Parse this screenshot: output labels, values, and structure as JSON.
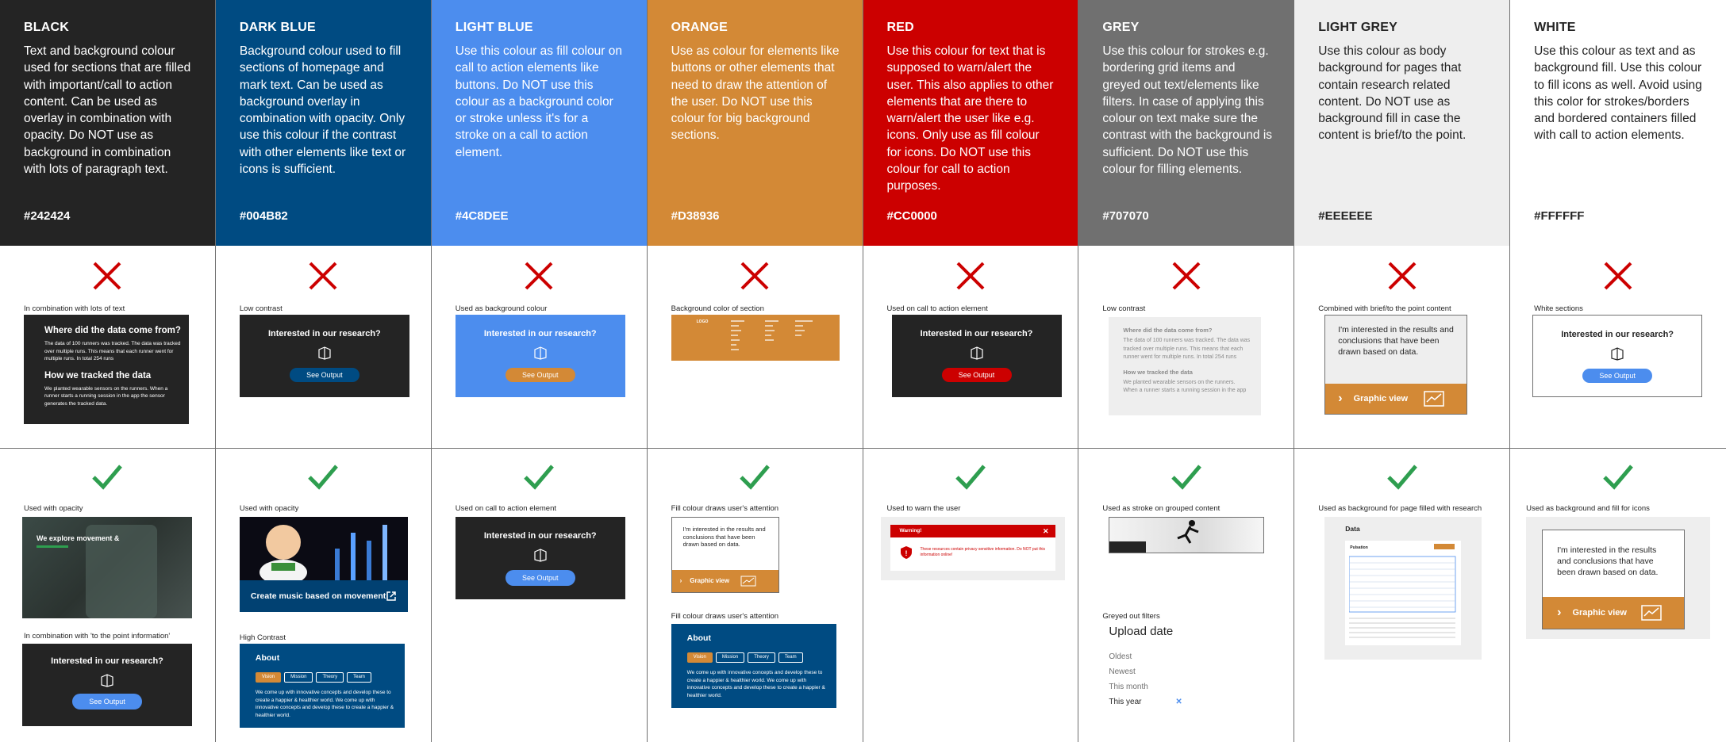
{
  "columns": [
    {
      "key": "black",
      "name": "BLACK",
      "bg": "#242424",
      "fg": "#FFFFFF",
      "hex": "#242424",
      "desc": "Text and background colour used for sections that are filled with important/call to action content. Can be used as overlay in combination with opacity. Do NOT use as background in combination with lots of paragraph text.",
      "dont_caption": "In combination with lots of text",
      "do_caption": "Used with opacity",
      "do_caption2": "In combination with 'to the point information'"
    },
    {
      "key": "darkblue",
      "name": "DARK BLUE",
      "bg": "#004B82",
      "fg": "#FFFFFF",
      "hex": "#004B82",
      "desc": "Background colour used to fill sections of homepage and mark text. Can be used as background overlay in combination with opacity. Only use this colour if the contrast with other elements like text or icons is sufficient.",
      "dont_caption": "Low contrast",
      "do_caption": "Used with opacity",
      "do_caption2": "High Contrast"
    },
    {
      "key": "lightblue",
      "name": "LIGHT BLUE",
      "bg": "#4C8DEE",
      "fg": "#FFFFFF",
      "hex": "#4C8DEE",
      "desc": "Use this colour as fill colour on call to action elements like buttons. Do NOT use this colour as a background color or stroke unless it's for a stroke on a call to action element.",
      "dont_caption": "Used as background colour",
      "do_caption": "Used on call to action element"
    },
    {
      "key": "orange",
      "name": "ORANGE",
      "bg": "#D38936",
      "fg": "#FFFFFF",
      "hex": "#D38936",
      "desc": "Use as colour for elements like buttons or other elements that need to draw the attention of the user. Do NOT use this colour for big background sections.",
      "dont_caption": "Background color of section",
      "do_caption": "Fill colour draws user's attention",
      "do_caption2": "Fill colour draws user's attention"
    },
    {
      "key": "red",
      "name": "RED",
      "bg": "#CC0000",
      "fg": "#FFFFFF",
      "hex": "#CC0000",
      "desc": "Use this colour for text that is supposed to warn/alert the user. This also applies to other elements that are there to warn/alert the user like e.g. icons. Only use as fill colour for icons. Do NOT use this colour for call to action purposes.",
      "dont_caption": "Used on call to action element",
      "do_caption": "Used to warn the user"
    },
    {
      "key": "grey",
      "name": "GREY",
      "bg": "#707070",
      "fg": "#FFFFFF",
      "hex": "#707070",
      "desc": "Use this colour for strokes e.g. bordering grid items and greyed out text/elements like filters. In case of applying this colour on text make sure the contrast with the background is sufficient. Do NOT use this colour for filling elements.",
      "dont_caption": "Low contrast",
      "do_caption": "Used as stroke on grouped content",
      "do_caption2": "Greyed out filters"
    },
    {
      "key": "lightgrey",
      "name": "LIGHT GREY",
      "bg": "#EEEEEE",
      "fg": "#242424",
      "hex": "#EEEEEE",
      "desc": "Use this colour as body background for pages that contain research related content. Do NOT use as background fill in case the content is brief/to the point.",
      "dont_caption": "Combined with brief/to the point content",
      "do_caption": "Used as background for page filled with research"
    },
    {
      "key": "white",
      "name": "WHITE",
      "bg": "#FFFFFF",
      "fg": "#242424",
      "hex": "#FFFFFF",
      "desc": "Use this colour as text and as background fill. Use this colour to fill icons as well. Avoid using this color for strokes/borders and bordered containers filled with call to action elements.",
      "dont_caption": "White sections",
      "do_caption": "Used as background and fill for icons"
    }
  ],
  "common": {
    "cta_question": "Interested in our research?",
    "cta_button": "See Output",
    "brief_text": "I'm interested in the results and conclusions that have been drawn based on data.",
    "graphic_view": "Graphic view",
    "data_title": "Where did the data come from?",
    "data_body": "The data of 100 runners was tracked. The data was tracked over multiple runs. This means that each runner went for multiple runs. In total 254 runs",
    "track_title": "How we tracked the data",
    "track_body": "We planted wearable sensors on the runners. When a runner starts a running session in the app the sensor generates the tracked data.",
    "explore_text": "We explore movement &",
    "music_text": "Create music based on movement",
    "about_title": "About",
    "about_tabs": [
      "Vision",
      "Mission",
      "Theory",
      "Team"
    ],
    "about_body": "We come up with innovative concepts and develop these to create a happier & healthier world. We come up with innovative concepts and develop these to create a happier & healthier world.",
    "warning_title": "Warning!",
    "warning_body": "These resources contain privacy sensitive information. Do NOT put this information online!",
    "filter_title": "Upload date",
    "filter_options": [
      "Oldest",
      "Newest",
      "This month",
      "This year"
    ],
    "data_page_title": "Data",
    "logo": "LOGO",
    "data_table_title": "Pulsation",
    "accents": {
      "check": "#2E9E4F",
      "cross": "#CC0000"
    }
  }
}
